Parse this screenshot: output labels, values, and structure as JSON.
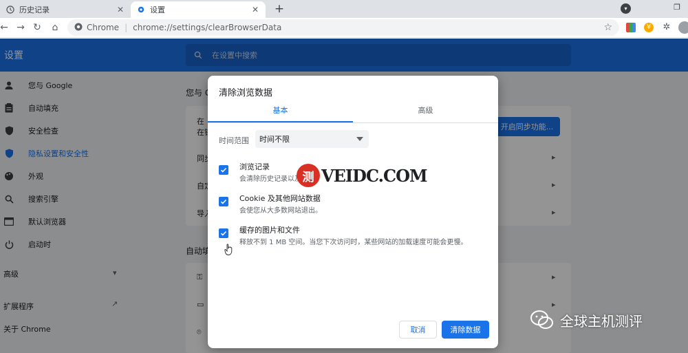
{
  "tabs": [
    {
      "label": "历史记录",
      "icon": "history-icon"
    },
    {
      "label": "设置",
      "icon": "gear-icon"
    }
  ],
  "toolbar": {
    "site_label": "Chrome",
    "url": "chrome://settings/clearBrowserData"
  },
  "header": {
    "title": "设置",
    "search_placeholder": "在设置中搜索"
  },
  "sidebar": {
    "items": [
      {
        "label": "您与 Google",
        "icon": "person-icon"
      },
      {
        "label": "自动填充",
        "icon": "clipboard-icon"
      },
      {
        "label": "安全检查",
        "icon": "shield-check-icon"
      },
      {
        "label": "隐私设置和安全性",
        "icon": "shield-icon",
        "active": true
      },
      {
        "label": "外观",
        "icon": "palette-icon"
      },
      {
        "label": "搜索引擎",
        "icon": "search-icon"
      },
      {
        "label": "默认浏览器",
        "icon": "browser-icon"
      },
      {
        "label": "启动时",
        "icon": "power-icon"
      }
    ],
    "advanced": "高级",
    "extensions": "扩展程序",
    "about": "关于 Chrome"
  },
  "content": {
    "section1_title": "您与 G",
    "row1a": "在",
    "row1b": "在钱",
    "sync_button": "开启同步功能...",
    "row2": "同步",
    "row3": "自定",
    "row4": "导入",
    "section2_title": "自动填"
  },
  "dialog": {
    "title": "清除浏览数据",
    "tabs": {
      "basic": "基本",
      "advanced": "高级"
    },
    "time_range_label": "时间范围",
    "time_range_value": "时间不限",
    "options": [
      {
        "title": "浏览记录",
        "desc": "会清除历史记录以及",
        "checked": true
      },
      {
        "title": "Cookie 及其他网站数据",
        "desc": "会使您从大多数网站退出。",
        "checked": true
      },
      {
        "title": "缓存的图片和文件",
        "desc": "释放不到 1 MB 空间。当您下次访问时，某些网站的加载速度可能会更慢。",
        "checked": true
      }
    ],
    "cancel": "取消",
    "clear": "清除数据"
  },
  "watermarks": {
    "center_seal": "测",
    "center_text": "VEIDC.COM",
    "bottom_text": "全球主机测评"
  },
  "colors": {
    "accent": "#1a73e8",
    "header": "#1a73e8",
    "tabstrip": "#dee1e6"
  }
}
